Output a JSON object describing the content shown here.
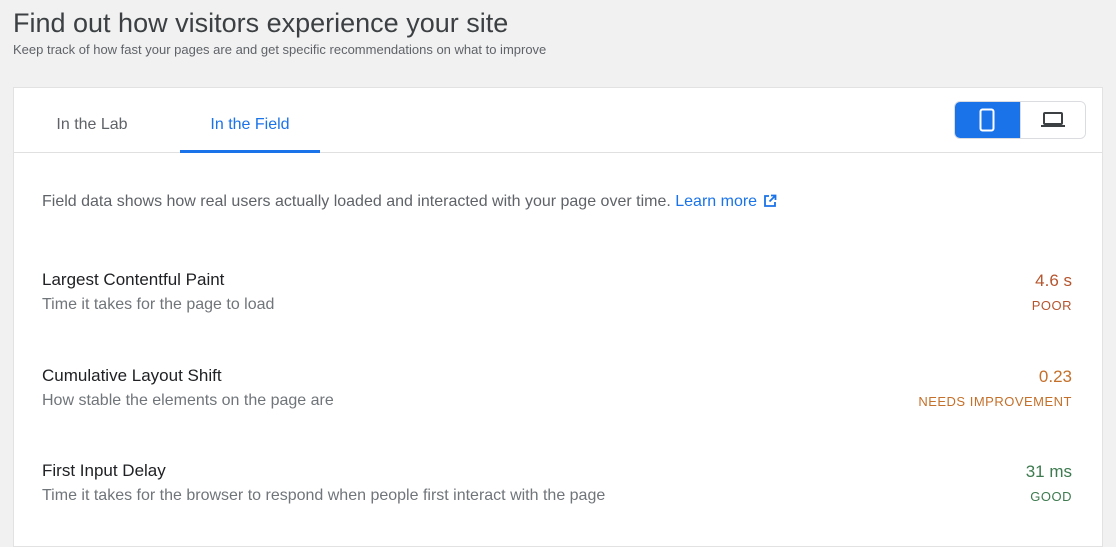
{
  "header": {
    "title": "Find out how visitors experience your site",
    "subtitle": "Keep track of how fast your pages are and get specific recommendations on what to improve"
  },
  "tabs": [
    {
      "label": "In the Lab",
      "active": false
    },
    {
      "label": "In the Field",
      "active": true
    }
  ],
  "device_toggle": {
    "selected": "mobile",
    "options": [
      {
        "icon": "mobile-phone-icon"
      },
      {
        "icon": "laptop-icon"
      }
    ]
  },
  "intro": {
    "text": "Field data shows how real users actually loaded and interacted with your page over time.",
    "link": "Learn more"
  },
  "metrics": [
    {
      "name": "Largest Contentful Paint",
      "description": "Time it takes for the page to load",
      "value": "4.6 s",
      "status": "POOR",
      "color": "#b5552e"
    },
    {
      "name": "Cumulative Layout Shift",
      "description": "How stable the elements on the page are",
      "value": "0.23",
      "status": "NEEDS IMPROVEMENT",
      "color": "#c4702a"
    },
    {
      "name": "First Input Delay",
      "description": "Time it takes for the browser to respond when people first interact with the page",
      "value": "31 ms",
      "status": "GOOD",
      "color": "#3d7a4f"
    }
  ],
  "colors": {
    "accent": "#1a73e8"
  }
}
